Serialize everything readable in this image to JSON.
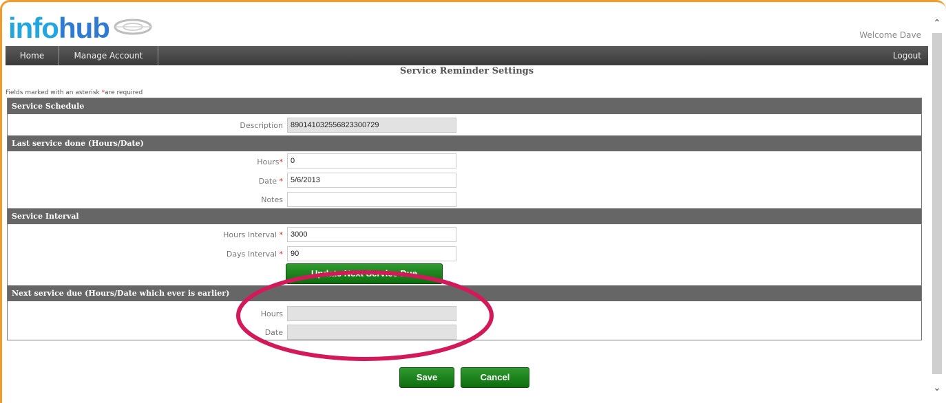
{
  "header": {
    "logo_prefix": "info",
    "logo_suffix": "hub",
    "welcome": "Welcome Dave"
  },
  "nav": {
    "home": "Home",
    "manage_account": "Manage Account",
    "logout": "Logout"
  },
  "page": {
    "title": "Service Reminder Settings",
    "required_note_prefix": "Fields marked with an asterisk ",
    "required_note_star": "*",
    "required_note_suffix": "are required"
  },
  "sections": {
    "schedule": {
      "header": "Service Schedule",
      "description_label": "Description",
      "description_value": "890141032556823300729"
    },
    "last_service": {
      "header": "Last service done (Hours/Date)",
      "hours_label": "Hours",
      "hours_value": "0",
      "date_label": "Date ",
      "date_value": "5/6/2013",
      "notes_label": "Notes",
      "notes_value": ""
    },
    "interval": {
      "header": "Service Interval",
      "hours_interval_label": "Hours Interval ",
      "hours_interval_value": "3000",
      "days_interval_label": "Days Interval ",
      "days_interval_value": "90",
      "update_button": "Update Next Service Due"
    },
    "next_due": {
      "header": "Next service due (Hours/Date which ever is earlier)",
      "hours_label": "Hours",
      "hours_value": "",
      "date_label": "Date",
      "date_value": ""
    }
  },
  "required_star": "*",
  "actions": {
    "save": "Save",
    "cancel": "Cancel"
  },
  "colors": {
    "frame_border": "#f39a2b",
    "section_header": "#666666",
    "button_green": "#1a7f1a",
    "highlight_ellipse": "#d4195a",
    "logo_blue": "#23a6e0"
  },
  "icons": {
    "logo_mark": "eye-lens-logo-icon",
    "scroll_up": "chevron-up-icon",
    "scroll_down": "chevron-down-icon"
  }
}
